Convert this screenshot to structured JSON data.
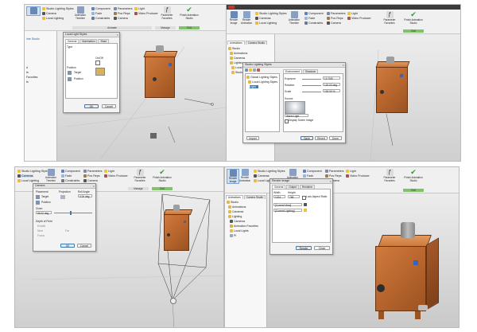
{
  "q1": {
    "ribbon": {
      "styles": "Studio Lighting Styles",
      "camera": "Camera",
      "local_lighting": "Local Lighting",
      "animation_timeline": "Animation Timeline",
      "component": "Component",
      "fade": "Fade",
      "constraints": "Constraints",
      "parameters": "Parameters",
      "pos_reps": "Pos Reps",
      "camera2": "Camera",
      "light": "Light",
      "video_producer": "Video Producer",
      "parameter_favorites": "Parameter Favorites",
      "finish": "Finish Animation Studio",
      "panel_animate": "Animate",
      "panel_manage": "Manage",
      "panel_exit": "Exit"
    },
    "browser": {
      "items": [
        "Inte Studio",
        "d",
        "ts",
        "Favorites",
        "ts"
      ]
    },
    "dialog": {
      "title": "Local Light Styles",
      "tabs": [
        "General",
        "Illumination",
        "Shad"
      ],
      "target_label": "Target",
      "target_value": "Target",
      "position_label": "Position",
      "on_off_label": "On/Off",
      "ok": "OK",
      "cancel": "Cancel"
    }
  },
  "q2": {
    "ribbon": {
      "render_image": "Render Image",
      "render_animation": "Render Animation",
      "studio_lighting_styles": "Studio Lighting Styles",
      "cameras": "Cameras",
      "local_lighting": "Local Lighting",
      "animation_timeline": "Animation Timeline",
      "component": "Component",
      "fade": "Fade",
      "constraints": "Constraints",
      "parameters": "Parameters",
      "pos_reps": "Pos Reps",
      "camera": "Camera",
      "light": "Light",
      "video_producer": "Video Producer",
      "parameter_favorites": "Parameter Favorites",
      "finish": "Finish Animation Studio",
      "panel_exit": "Exit"
    },
    "browser": {
      "tabs": [
        "Animations",
        "Camera Studio"
      ],
      "items": [
        "Studio",
        "Animations",
        "Cameras",
        "Lighting",
        "Local Lights",
        "Studio lighting"
      ]
    },
    "dialog": {
      "title": "Studio Lighting Styles",
      "tree": [
        "Global Lighting Styles",
        "Local Lighting Styles",
        "Light"
      ],
      "tabs": [
        "Environment",
        "Shadows"
      ],
      "exposure_label": "Exposure",
      "exposure_value": "13.7ND",
      "rotation_label": "Rotation",
      "rotation_value": "120.00 deg",
      "scale_label": "Scale",
      "scale_value": "100.00 %",
      "source_label": "Source",
      "source_value": "Warm Light",
      "display_scene_image": "Display Scene Image",
      "import": "Import",
      "save": "Save",
      "revert": "Revert",
      "done": "Done"
    }
  },
  "q3": {
    "ribbon": {
      "studio_lighting_styles": "Studio Lighting Styles",
      "cameras": "Cameras",
      "local_lighting": "Local Lighting",
      "animation_timeline": "Animation Timeline",
      "component": "Component",
      "fade": "Fade",
      "constraints": "Constraints",
      "parameters": "Parameters",
      "pos_reps": "Pos Reps",
      "camera": "Camera",
      "light": "Light",
      "video_producer": "Video Producer",
      "parameter_favorites": "Parameter Favorites",
      "finish": "Finish Animation Studio",
      "panel_manage": "Manage",
      "panel_exit": "Exit"
    },
    "dialog": {
      "title": "Camera",
      "placement": "Placement",
      "projection": "Projection",
      "roll_angle": "Roll Angle",
      "roll_value": "0.00 deg",
      "target_label": "Target",
      "position_label": "Position",
      "zoom_label": "Zoom",
      "zoom_value": "56.00 deg",
      "depth_of_field": "Depth of Field",
      "enable": "Enable",
      "near": "Near",
      "far": "Far",
      "focus": "Focus",
      "ok": "OK",
      "cancel": "Cancel"
    }
  },
  "q4": {
    "ribbon": {
      "render_image": "Render Image",
      "render_animation": "Render Animation",
      "studio_lighting_styles": "Studio Lighting Styles",
      "cameras": "Cameras",
      "local_lighting": "Local Lighting",
      "animation_timeline": "Animation Timeline",
      "component": "Component",
      "fade": "Fade",
      "constraints": "Constraints",
      "parameters": "Parameters",
      "pos_reps": "Pos Reps",
      "camera": "Camera",
      "light": "Light",
      "video_producer": "Video Producer",
      "parameter_favorites": "Parameter Favorites",
      "finish": "Finish Animation Studio",
      "panel_exit": "Exit"
    },
    "browser": {
      "tabs": [
        "Animations",
        "Camera Studio"
      ],
      "items": [
        "Studio",
        "Animations",
        "Cameras",
        "Lighting",
        "Cameras",
        "Animation Favorites",
        "Local Lights",
        "Pl"
      ]
    },
    "dialog": {
      "title": "Render Image",
      "tabs": [
        "General",
        "Output",
        "Renderer"
      ],
      "width_label": "Width",
      "height_label": "Height",
      "width_value": "1024",
      "height_value": "768",
      "lock_aspect": "Lock Aspect Ratio",
      "camera_select": "[Current View]",
      "lighting_select": "[Current Lighting]",
      "render": "Render",
      "close": "Close"
    }
  },
  "colors": {
    "wood": "#c46f35",
    "green": "#7fc36a",
    "accent": "#3d7ab3"
  }
}
